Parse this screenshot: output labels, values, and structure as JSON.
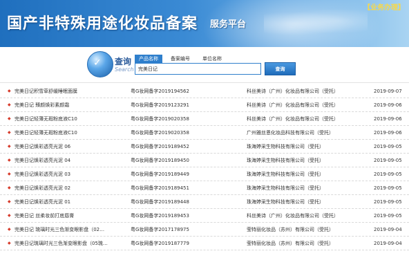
{
  "banner": {
    "title": "国产非特殊用途化妆品备案",
    "subtitle": "服务平台",
    "link": "【业务办理】"
  },
  "search": {
    "label": "查询",
    "label_en": "Search",
    "tabs": [
      {
        "label": "产品名称",
        "active": true
      },
      {
        "label": "备案编号",
        "active": false
      },
      {
        "label": "单位名称",
        "active": false
      }
    ],
    "input_value": "完美日记",
    "button_label": "查询"
  },
  "rows": [
    {
      "name": "完美日记积雪草舒缓睡眠面膜",
      "reg": "粤G妆网备字2019194562",
      "company": "科丝美诗（广州）化妆品有限公司（受托）",
      "date": "2019-09-07"
    },
    {
      "name": "完美日记 臻颜焕彩素颜霜",
      "reg": "粤G妆网备字2019123291",
      "company": "科丝美诗（广州）化妆品有限公司（受托）",
      "date": "2019-09-06"
    },
    {
      "name": "完美日记轻薄无瑕粉底液C10",
      "reg": "粤G妆网备字2019020358",
      "company": "科丝美诗（广州）化妆品有限公司（受托）",
      "date": "2019-09-06"
    },
    {
      "name": "完美日记轻薄无瑕粉底液C10",
      "reg": "粤G妆网备字2019020358",
      "company": "广州雅丝恩化妆品科技有限公司（受托）",
      "date": "2019-09-06"
    },
    {
      "name": "完美日记焕彩透亮光泥 06",
      "reg": "粤G妆网备字2019189452",
      "company": "珠海婷采生物科技有限公司（受托）",
      "date": "2019-09-05"
    },
    {
      "name": "完美日记焕彩透亮光泥 04",
      "reg": "粤G妆网备字2019189450",
      "company": "珠海婷采生物科技有限公司（受托）",
      "date": "2019-09-05"
    },
    {
      "name": "完美日记焕彩透亮光泥 03",
      "reg": "粤G妆网备字2019189449",
      "company": "珠海婷采生物科技有限公司（受托）",
      "date": "2019-09-05"
    },
    {
      "name": "完美日记焕彩透亮光泥 02",
      "reg": "粤G妆网备字2019189451",
      "company": "珠海婷采生物科技有限公司（受托）",
      "date": "2019-09-05"
    },
    {
      "name": "完美日记焕彩透亮光泥 01",
      "reg": "粤G妆网备字2019189448",
      "company": "珠海婷采生物科技有限公司（受托）",
      "date": "2019-09-05"
    },
    {
      "name": "完美日记 丝柔妆前打底唇膏",
      "reg": "粤G妆网备字2019189453",
      "company": "科丝美诗（广州）化妆品有限公司（受托）",
      "date": "2019-09-05"
    },
    {
      "name": "完美日记 琉璃时光三色渐变眼影盘（02…",
      "reg": "粤G妆网备字2017178975",
      "company": "莹特丽化妆品（苏州）有限公司（受托）",
      "date": "2019-09-04"
    },
    {
      "name": "完美日记琉璃时光三色渐变眼影盘（05琉…",
      "reg": "粤G妆网备字2019187779",
      "company": "莹特丽化妆品（苏州）有限公司（受托）",
      "date": "2019-09-04"
    }
  ]
}
